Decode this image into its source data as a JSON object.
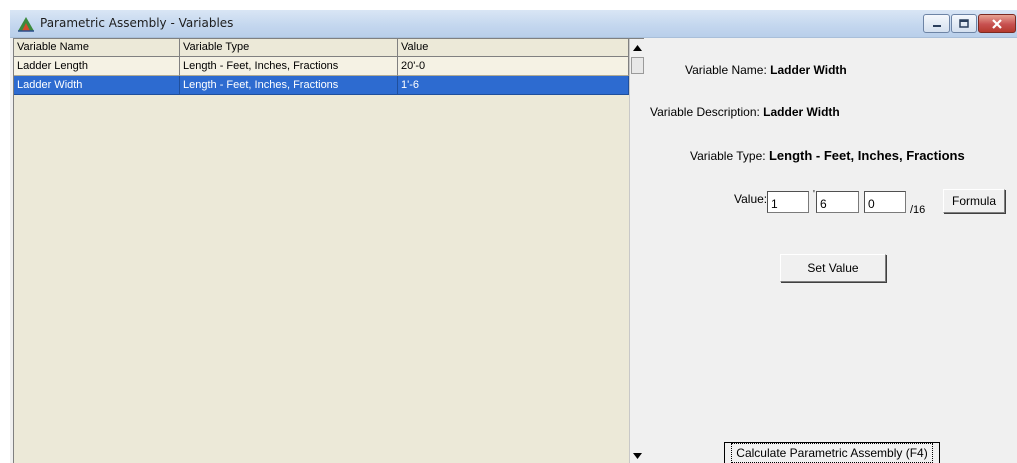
{
  "window": {
    "title": "Parametric Assembly - Variables",
    "icon": "parametric-assembly-icon",
    "controls": [
      "minimize-icon",
      "maximize-icon",
      "close-icon"
    ]
  },
  "grid": {
    "columns": [
      "Variable Name",
      "Variable Type",
      "Value"
    ],
    "rows": [
      {
        "name": "Ladder Length",
        "type": "Length - Feet, Inches, Fractions",
        "value": "20'-0",
        "selected": false
      },
      {
        "name": "Ladder Width",
        "type": "Length - Feet, Inches, Fractions",
        "value": "1'-6",
        "selected": true
      }
    ]
  },
  "details": {
    "name_label": "Variable Name:",
    "name_value": "Ladder Width",
    "description_label": "Variable Description:",
    "description_value": "Ladder Width",
    "type_label": "Variable Type:",
    "type_value": "Length - Feet, Inches, Fractions",
    "value_label": "Value:",
    "feet": "1",
    "feet_mark": "'",
    "inches": "6",
    "fraction": "0",
    "fraction_denominator": "/16"
  },
  "buttons": {
    "formula": "Formula",
    "set_value": "Set Value",
    "calculate": "Calculate Parametric Assembly (F4)"
  },
  "colors": {
    "selection": "#2d6bd0",
    "grid_background": "#ece9d8",
    "close_button": "#c75050"
  }
}
